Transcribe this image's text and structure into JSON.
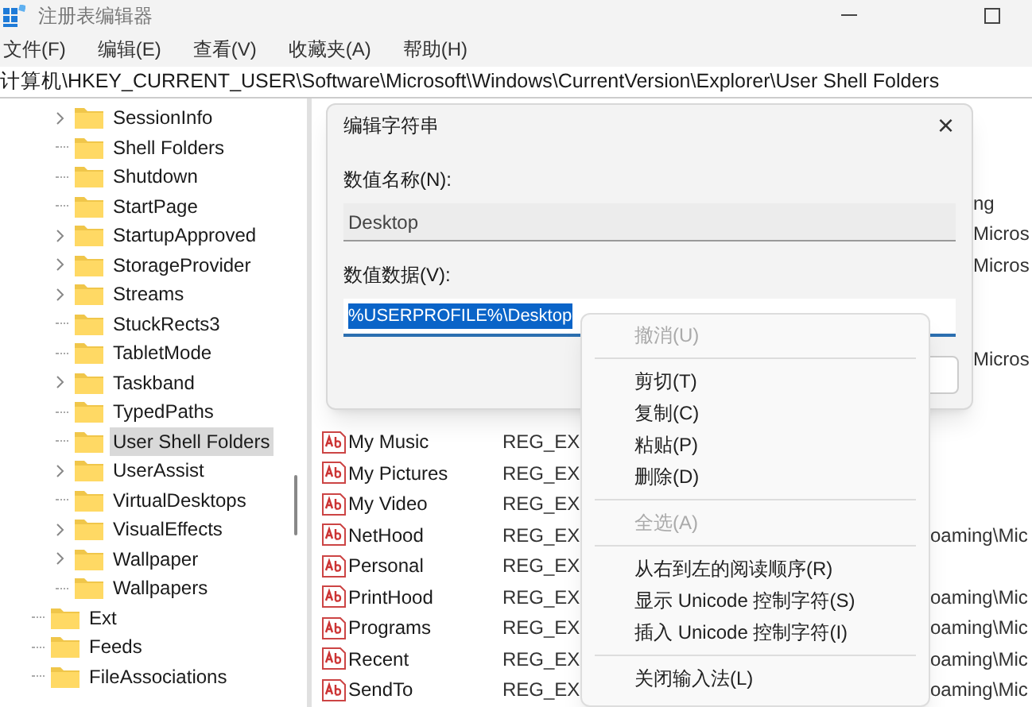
{
  "window": {
    "title": "注册表编辑器"
  },
  "menu": [
    "文件(F)",
    "编辑(E)",
    "查看(V)",
    "收藏夹(A)",
    "帮助(H)"
  ],
  "address": "计算机\\HKEY_CURRENT_USER\\Software\\Microsoft\\Windows\\CurrentVersion\\Explorer\\User Shell Folders",
  "tree": [
    {
      "children": [
        {
          "label": "SessionInfo",
          "expandable": true,
          "selected": false
        },
        {
          "label": "Shell Folders",
          "expandable": false,
          "selected": false
        },
        {
          "label": "Shutdown",
          "expandable": false,
          "selected": false
        },
        {
          "label": "StartPage",
          "expandable": false,
          "selected": false
        },
        {
          "label": "StartupApproved",
          "expandable": true,
          "selected": false
        },
        {
          "label": "StorageProvider",
          "expandable": true,
          "selected": false
        },
        {
          "label": "Streams",
          "expandable": true,
          "selected": false
        },
        {
          "label": "StuckRects3",
          "expandable": false,
          "selected": false
        },
        {
          "label": "TabletMode",
          "expandable": false,
          "selected": false
        },
        {
          "label": "Taskband",
          "expandable": true,
          "selected": false
        },
        {
          "label": "TypedPaths",
          "expandable": false,
          "selected": false
        },
        {
          "label": "User Shell Folders",
          "expandable": false,
          "selected": true
        },
        {
          "label": "UserAssist",
          "expandable": true,
          "selected": false
        },
        {
          "label": "VirtualDesktops",
          "expandable": false,
          "selected": false
        },
        {
          "label": "VisualEffects",
          "expandable": true,
          "selected": false
        },
        {
          "label": "Wallpaper",
          "expandable": true,
          "selected": false
        },
        {
          "label": "Wallpapers",
          "expandable": false,
          "selected": false
        }
      ]
    },
    {
      "label": "Ext",
      "expandable": false,
      "selected": false
    },
    {
      "label": "Feeds",
      "expandable": false,
      "selected": false
    },
    {
      "label": "FileAssociations",
      "expandable": false,
      "selected": false
    }
  ],
  "values": [
    {
      "data": "ng"
    },
    {
      "data": "Micros"
    },
    {
      "data": "Micros"
    },
    {
      "data": "Micros"
    },
    {
      "name": "My Music",
      "type": "REG_EX"
    },
    {
      "name": "My Pictures",
      "type": "REG_EX"
    },
    {
      "name": "My Video",
      "type": "REG_EX"
    },
    {
      "name": "NetHood",
      "type": "REG_EX",
      "data": "oaming\\Mic"
    },
    {
      "name": "Personal",
      "type": "REG_EX"
    },
    {
      "name": "PrintHood",
      "type": "REG_EX",
      "data": "oaming\\Mic"
    },
    {
      "name": "Programs",
      "type": "REG_EX",
      "data": "oaming\\Mic"
    },
    {
      "name": "Recent",
      "type": "REG_EX",
      "data": "oaming\\Mic"
    },
    {
      "name": "SendTo",
      "type": "REG_EX",
      "data": "oaming\\Mic"
    }
  ],
  "dialog": {
    "title": "编辑字符串",
    "close": "×",
    "name_label": "数值名称(N):",
    "name_value": "Desktop",
    "data_label": "数值数据(V):",
    "data_value": "%USERPROFILE%\\Desktop"
  },
  "context_menu": [
    {
      "kind": "item",
      "label": "撤消(U)",
      "disabled": true
    },
    {
      "kind": "separator"
    },
    {
      "kind": "item",
      "label": "剪切(T)",
      "disabled": false
    },
    {
      "kind": "item",
      "label": "复制(C)",
      "disabled": false
    },
    {
      "kind": "item",
      "label": "粘贴(P)",
      "disabled": false
    },
    {
      "kind": "item",
      "label": "删除(D)",
      "disabled": false
    },
    {
      "kind": "separator"
    },
    {
      "kind": "item",
      "label": "全选(A)",
      "disabled": true
    },
    {
      "kind": "separator"
    },
    {
      "kind": "item",
      "label": "从右到左的阅读顺序(R)",
      "disabled": false
    },
    {
      "kind": "item",
      "label": "显示 Unicode 控制字符(S)",
      "disabled": false
    },
    {
      "kind": "item",
      "label": "插入 Unicode 控制字符(I)",
      "disabled": false
    },
    {
      "kind": "separator"
    },
    {
      "kind": "item",
      "label": "关闭输入法(L)",
      "disabled": false
    }
  ]
}
